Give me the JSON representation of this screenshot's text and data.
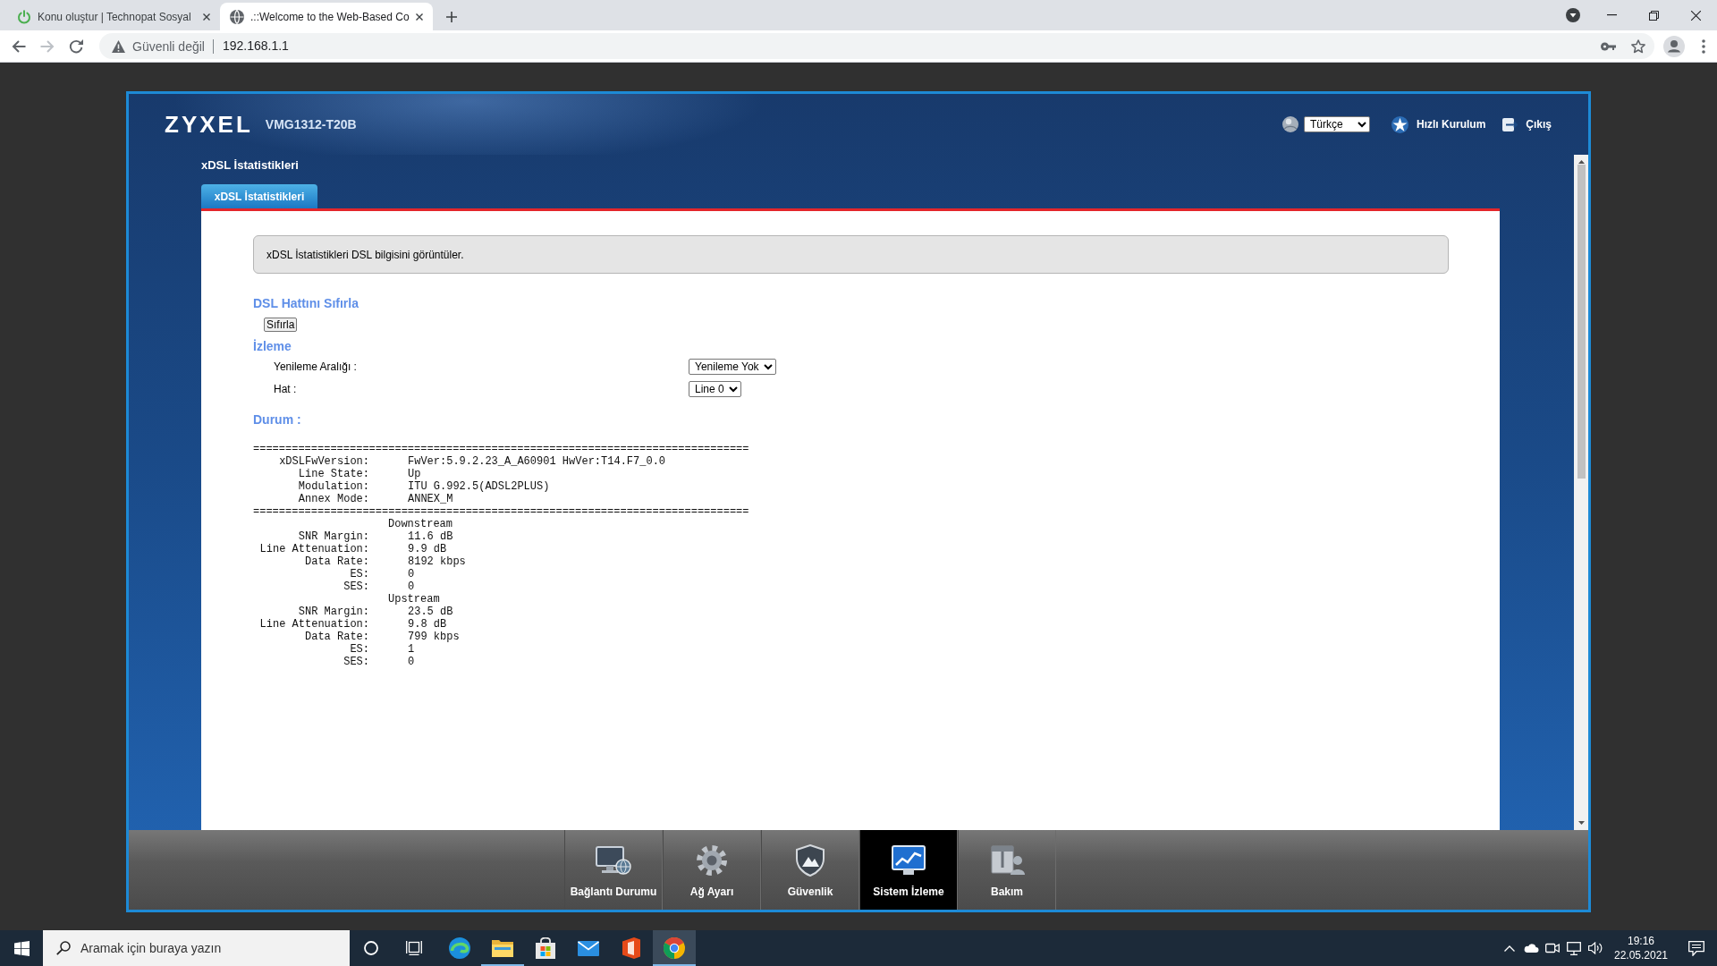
{
  "browser": {
    "tabs": [
      {
        "title": "Konu oluştur | Technopat Sosyal",
        "selected": false
      },
      {
        "title": ".::Welcome to the Web-Based Co",
        "selected": true
      }
    ],
    "forward_disabled": true,
    "security_label": "Güvenli değil",
    "url": "192.168.1.1"
  },
  "router": {
    "logo": "ZYXEL",
    "model": "VMG1312-T20B",
    "language": "Türkçe",
    "quick_setup": "Hızlı Kurulum",
    "logout": "Çıkış",
    "page_title": "xDSL İstatistikleri",
    "tabs": [
      {
        "label": "xDSL İstatistikleri",
        "selected": true
      }
    ],
    "description": "xDSL İstatistikleri DSL bilgisini görüntüler.",
    "reset": {
      "heading": "DSL Hattını Sıfırla",
      "button": "Sıfırla"
    },
    "monitoring": {
      "heading": "İzleme",
      "fields": [
        {
          "label": "Yenileme Aralığı :",
          "value": "Yenileme Yok"
        },
        {
          "label": "Hat :",
          "value": "Line 0"
        }
      ]
    },
    "status": {
      "heading": "Durum :",
      "separator_top": "=============================================================================",
      "info": [
        {
          "label": "xDSLFwVersion:",
          "value": "FwVer:5.9.2.23_A_A60901 HwVer:T14.F7_0.0"
        },
        {
          "label": "Line State:",
          "value": "Up"
        },
        {
          "label": "Modulation:",
          "value": "ITU G.992.5(ADSL2PLUS)"
        },
        {
          "label": "Annex Mode:",
          "value": "ANNEX_M"
        }
      ],
      "separator_bottom": "=============================================================================",
      "streams": [
        {
          "title": "Downstream",
          "rows": [
            {
              "label": "SNR Margin:",
              "value": "11.6 dB"
            },
            {
              "label": "Line Attenuation:",
              "value": "9.9 dB"
            },
            {
              "label": "Data Rate:",
              "value": "8192 kbps"
            },
            {
              "label": "ES:",
              "value": "0"
            },
            {
              "label": "SES:",
              "value": "0"
            }
          ]
        },
        {
          "title": "Upstream",
          "rows": [
            {
              "label": "SNR Margin:",
              "value": "23.5 dB"
            },
            {
              "label": "Line Attenuation:",
              "value": "9.8 dB"
            },
            {
              "label": "Data Rate:",
              "value": "799 kbps"
            },
            {
              "label": "ES:",
              "value": "1"
            },
            {
              "label": "SES:",
              "value": "0"
            }
          ]
        }
      ]
    }
  },
  "bottom_nav": [
    {
      "label": "Bağlantı Durumu",
      "kind": "connection",
      "selected": false
    },
    {
      "label": "Ağ Ayarı",
      "kind": "network",
      "selected": false
    },
    {
      "label": "Güvenlik",
      "kind": "security",
      "selected": false
    },
    {
      "label": "Sistem İzleme",
      "kind": "monitor",
      "selected": true
    },
    {
      "label": "Bakım",
      "kind": "maintenance",
      "selected": false
    }
  ],
  "taskbar": {
    "search": {
      "placeholder": "Aramak için buraya yazın"
    },
    "apps": [
      {
        "kind": "swirl",
        "running": false,
        "selected": false
      },
      {
        "kind": "folder",
        "running": true,
        "selected": false
      },
      {
        "kind": "bag",
        "running": false,
        "selected": false
      },
      {
        "kind": "mail",
        "running": false,
        "selected": false
      },
      {
        "kind": "tile",
        "running": false,
        "selected": false
      },
      {
        "kind": "round",
        "running": true,
        "selected": true
      }
    ],
    "time": "19:16",
    "date": "22.05.2021"
  }
}
